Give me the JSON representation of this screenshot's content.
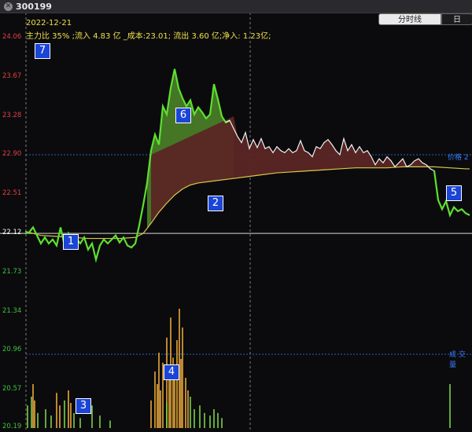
{
  "window": {
    "title": "300199"
  },
  "tabs": [
    {
      "label": "分时线"
    },
    {
      "label": "日"
    }
  ],
  "header": {
    "date": "2022-12-21",
    "info": "主力比 35% ;流入 4.83 亿 _成本:23.01; 流出 3.60 亿;净入: 1.23亿;"
  },
  "ref_labels": {
    "price": "价格 2",
    "volume": "成 交 量"
  },
  "markers": [
    "1",
    "2",
    "3",
    "4",
    "5",
    "6",
    "7"
  ],
  "colors": {
    "price_line": "#5de030",
    "avg_line": "#d9c84a",
    "fill_red": "#5b2624",
    "fill_green": "#4f8a2a",
    "vol_orange": "#e8a83a",
    "vol_green": "#7bd04a",
    "ref_blue": "#3a7bff",
    "axis_red": "#e04040",
    "axis_green": "#40c040"
  },
  "chart_data": {
    "type": "line",
    "ylim": [
      20.19,
      24.06
    ],
    "y_ticks": [
      {
        "label": "24.06",
        "value": 24.06
      },
      {
        "label": "23.67",
        "value": 23.67
      },
      {
        "label": "23.28",
        "value": 23.28
      },
      {
        "label": "22.90",
        "value": 22.9
      },
      {
        "label": "22.51",
        "value": 22.51
      },
      {
        "label": "22.12",
        "value": 22.12
      },
      {
        "label": "21.73",
        "value": 21.73
      },
      {
        "label": "21.34",
        "value": 21.34
      },
      {
        "label": "20.96",
        "value": 20.96
      },
      {
        "label": "20.57",
        "value": 20.57
      },
      {
        "label": "20.19",
        "value": 20.19
      }
    ],
    "prev_close": 22.12,
    "price": [
      [
        0,
        22.12
      ],
      [
        5,
        22.13
      ],
      [
        10,
        22.18
      ],
      [
        15,
        22.1
      ],
      [
        20,
        22.02
      ],
      [
        25,
        22.08
      ],
      [
        30,
        22.02
      ],
      [
        35,
        22.06
      ],
      [
        40,
        22.0
      ],
      [
        45,
        22.18
      ],
      [
        50,
        22.0
      ],
      [
        55,
        22.12
      ],
      [
        60,
        22.04
      ],
      [
        65,
        22.07
      ],
      [
        70,
        22.02
      ],
      [
        75,
        22.08
      ],
      [
        80,
        21.96
      ],
      [
        85,
        22.02
      ],
      [
        90,
        21.86
      ],
      [
        95,
        22.0
      ],
      [
        100,
        22.06
      ],
      [
        105,
        22.02
      ],
      [
        110,
        22.06
      ],
      [
        115,
        22.1
      ],
      [
        120,
        22.03
      ],
      [
        125,
        22.08
      ],
      [
        130,
        22.0
      ],
      [
        135,
        21.98
      ],
      [
        140,
        22.02
      ],
      [
        145,
        22.2
      ],
      [
        150,
        22.4
      ],
      [
        155,
        22.62
      ],
      [
        160,
        22.94
      ],
      [
        165,
        23.1
      ],
      [
        170,
        23.0
      ],
      [
        175,
        23.38
      ],
      [
        180,
        23.3
      ],
      [
        185,
        23.56
      ],
      [
        190,
        23.75
      ],
      [
        195,
        23.56
      ],
      [
        200,
        23.46
      ],
      [
        205,
        23.38
      ],
      [
        210,
        23.44
      ],
      [
        215,
        23.3
      ],
      [
        220,
        23.37
      ],
      [
        225,
        23.32
      ],
      [
        230,
        23.26
      ],
      [
        235,
        23.3
      ],
      [
        240,
        23.6
      ],
      [
        245,
        23.45
      ],
      [
        250,
        23.28
      ],
      [
        255,
        23.22
      ],
      [
        260,
        23.24
      ],
      [
        265,
        23.16
      ],
      [
        270,
        23.08
      ],
      [
        275,
        23.02
      ],
      [
        280,
        23.12
      ],
      [
        285,
        22.96
      ],
      [
        290,
        23.05
      ],
      [
        295,
        22.97
      ],
      [
        300,
        23.06
      ],
      [
        305,
        22.96
      ],
      [
        310,
        22.98
      ],
      [
        315,
        22.92
      ],
      [
        320,
        22.98
      ],
      [
        325,
        22.94
      ],
      [
        330,
        22.92
      ],
      [
        335,
        22.96
      ],
      [
        340,
        22.92
      ],
      [
        345,
        22.94
      ],
      [
        350,
        23.04
      ],
      [
        355,
        22.94
      ],
      [
        360,
        22.92
      ],
      [
        365,
        22.88
      ],
      [
        370,
        22.98
      ],
      [
        375,
        22.96
      ],
      [
        380,
        23.02
      ],
      [
        385,
        23.05
      ],
      [
        390,
        23.0
      ],
      [
        395,
        22.94
      ],
      [
        400,
        22.9
      ],
      [
        405,
        23.06
      ],
      [
        410,
        22.94
      ],
      [
        415,
        23.0
      ],
      [
        420,
        22.92
      ],
      [
        425,
        22.98
      ],
      [
        430,
        22.92
      ],
      [
        435,
        22.94
      ],
      [
        440,
        22.88
      ],
      [
        445,
        22.8
      ],
      [
        450,
        22.86
      ],
      [
        455,
        22.82
      ],
      [
        460,
        22.88
      ],
      [
        465,
        22.84
      ],
      [
        470,
        22.78
      ],
      [
        475,
        22.82
      ],
      [
        480,
        22.86
      ],
      [
        485,
        22.78
      ],
      [
        490,
        22.8
      ],
      [
        495,
        22.84
      ],
      [
        500,
        22.86
      ],
      [
        505,
        22.82
      ],
      [
        510,
        22.8
      ],
      [
        515,
        22.76
      ],
      [
        520,
        22.74
      ],
      [
        525,
        22.45
      ],
      [
        530,
        22.36
      ],
      [
        535,
        22.44
      ],
      [
        540,
        22.3
      ],
      [
        545,
        22.38
      ],
      [
        550,
        22.34
      ],
      [
        555,
        22.36
      ],
      [
        560,
        22.32
      ],
      [
        565,
        22.3
      ]
    ],
    "avg": [
      [
        0,
        22.14
      ],
      [
        20,
        22.1
      ],
      [
        40,
        22.09
      ],
      [
        60,
        22.08
      ],
      [
        80,
        22.07
      ],
      [
        100,
        22.07
      ],
      [
        120,
        22.07
      ],
      [
        140,
        22.08
      ],
      [
        150,
        22.12
      ],
      [
        160,
        22.22
      ],
      [
        170,
        22.33
      ],
      [
        180,
        22.42
      ],
      [
        190,
        22.5
      ],
      [
        200,
        22.56
      ],
      [
        210,
        22.6
      ],
      [
        220,
        22.62
      ],
      [
        240,
        22.64
      ],
      [
        260,
        22.66
      ],
      [
        280,
        22.68
      ],
      [
        300,
        22.7
      ],
      [
        320,
        22.72
      ],
      [
        340,
        22.73
      ],
      [
        360,
        22.74
      ],
      [
        380,
        22.75
      ],
      [
        400,
        22.76
      ],
      [
        420,
        22.77
      ],
      [
        440,
        22.77
      ],
      [
        460,
        22.77
      ],
      [
        480,
        22.78
      ],
      [
        500,
        22.78
      ],
      [
        520,
        22.78
      ],
      [
        540,
        22.77
      ],
      [
        560,
        22.76
      ],
      [
        565,
        22.76
      ]
    ],
    "volume_orange": [
      [
        10,
        0.35
      ],
      [
        12,
        0.22
      ],
      [
        40,
        0.28
      ],
      [
        44,
        0.18
      ],
      [
        55,
        0.3
      ],
      [
        58,
        0.2
      ],
      [
        160,
        0.22
      ],
      [
        165,
        0.45
      ],
      [
        168,
        0.35
      ],
      [
        170,
        0.6
      ],
      [
        172,
        0.3
      ],
      [
        175,
        0.52
      ],
      [
        180,
        0.72
      ],
      [
        183,
        0.4
      ],
      [
        185,
        0.88
      ],
      [
        188,
        0.56
      ],
      [
        190,
        0.48
      ],
      [
        193,
        0.7
      ],
      [
        196,
        0.95
      ],
      [
        198,
        0.55
      ],
      [
        200,
        0.8
      ],
      [
        204,
        0.4
      ],
      [
        207,
        0.3
      ]
    ],
    "volume_green": [
      [
        3,
        0.18
      ],
      [
        8,
        0.25
      ],
      [
        16,
        0.12
      ],
      [
        26,
        0.15
      ],
      [
        33,
        0.1
      ],
      [
        50,
        0.22
      ],
      [
        62,
        0.12
      ],
      [
        70,
        0.08
      ],
      [
        85,
        0.18
      ],
      [
        95,
        0.1
      ],
      [
        108,
        0.06
      ],
      [
        180,
        0.2
      ],
      [
        210,
        0.25
      ],
      [
        215,
        0.15
      ],
      [
        222,
        0.18
      ],
      [
        228,
        0.12
      ],
      [
        235,
        0.1
      ],
      [
        240,
        0.15
      ],
      [
        245,
        0.12
      ],
      [
        250,
        0.08
      ],
      [
        540,
        0.35
      ]
    ]
  }
}
